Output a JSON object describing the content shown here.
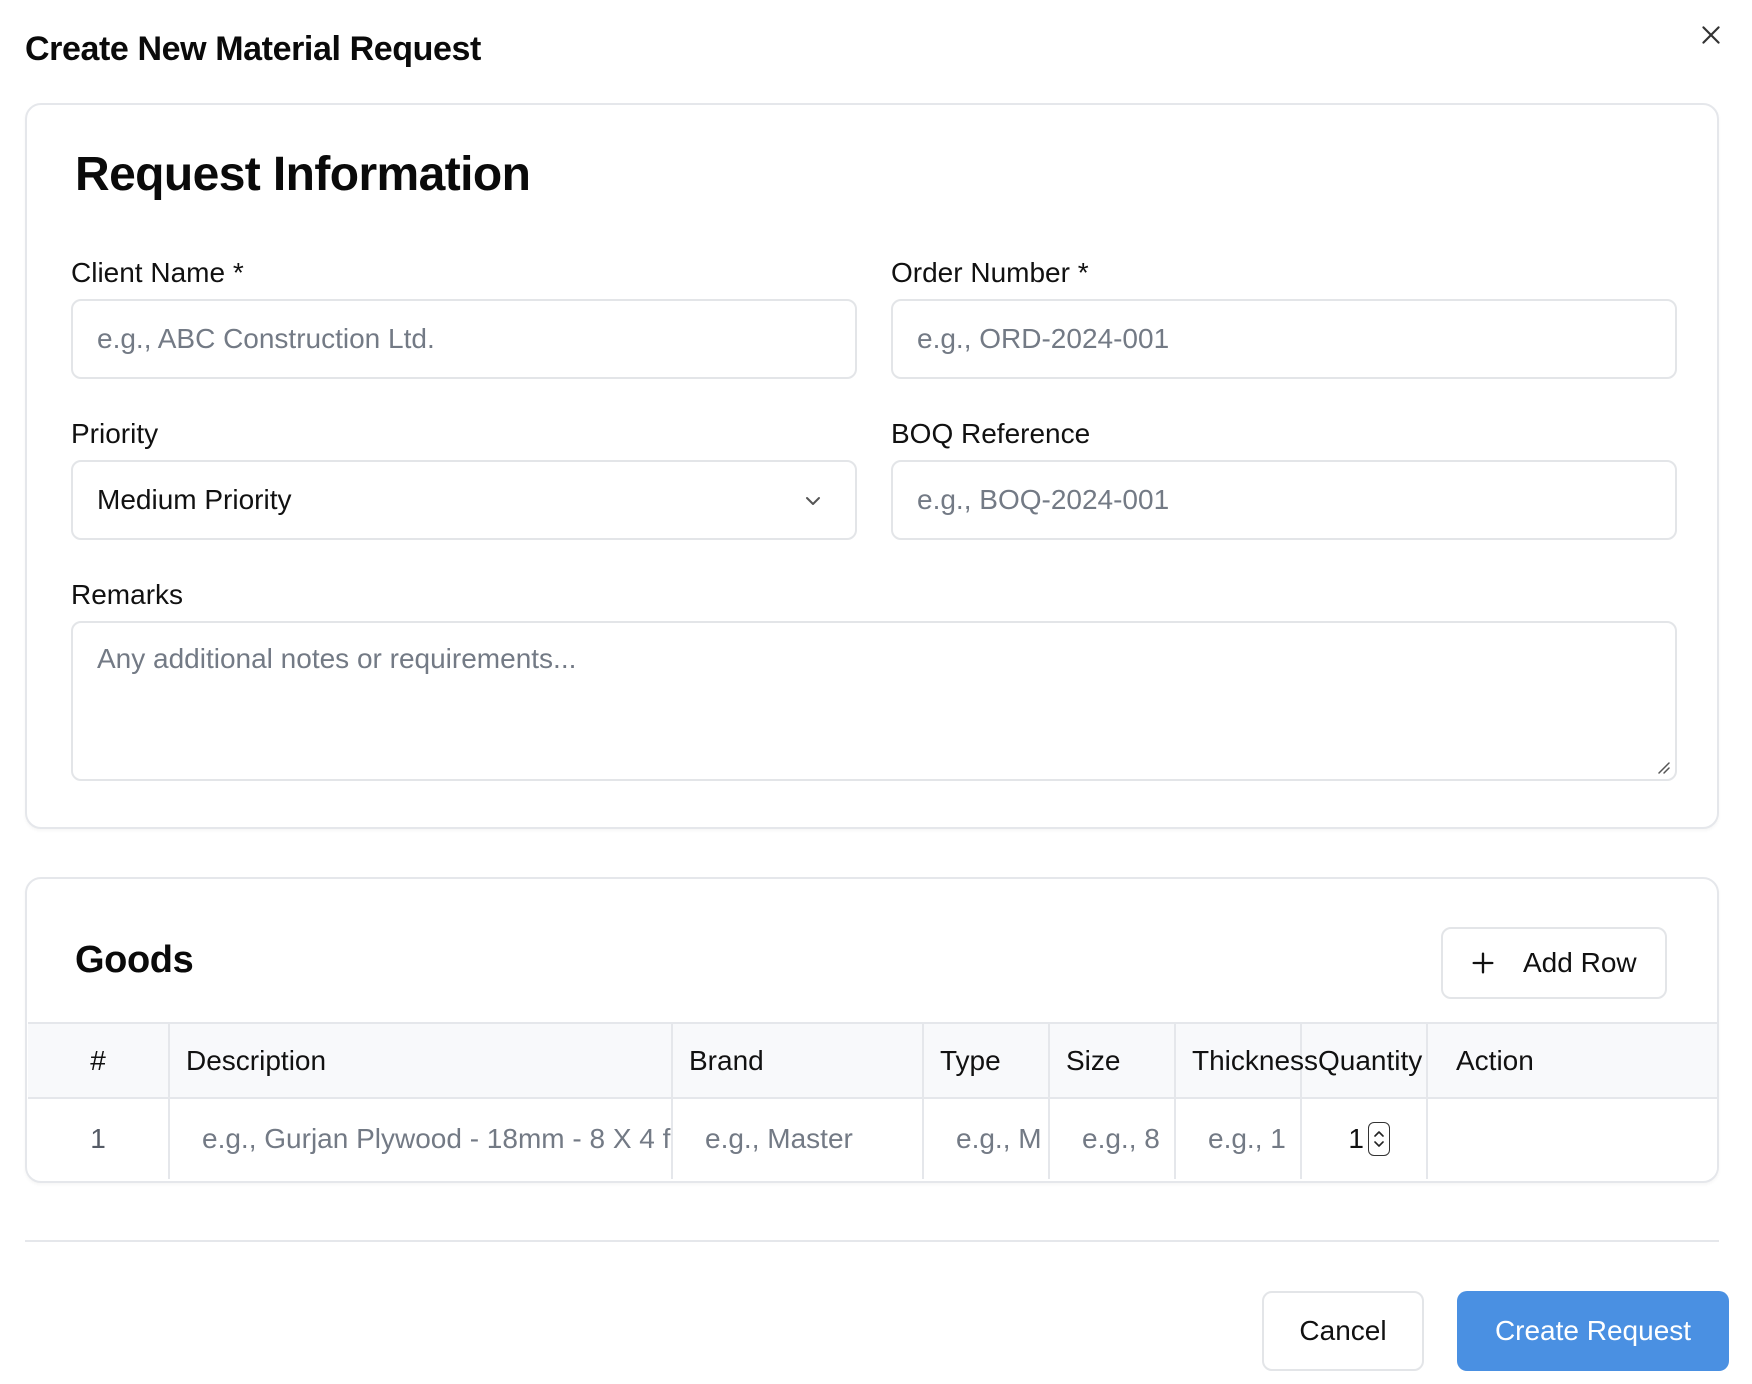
{
  "dialog": {
    "title": "Create New Material Request"
  },
  "request_info": {
    "title": "Request Information",
    "client_name": {
      "label": "Client Name *",
      "placeholder": "e.g., ABC Construction Ltd.",
      "value": ""
    },
    "order_number": {
      "label": "Order Number *",
      "placeholder": "e.g., ORD-2024-001",
      "value": ""
    },
    "priority": {
      "label": "Priority",
      "selected": "Medium Priority"
    },
    "boq_reference": {
      "label": "BOQ Reference",
      "placeholder": "e.g., BOQ-2024-001",
      "value": ""
    },
    "remarks": {
      "label": "Remarks",
      "placeholder": "Any additional notes or requirements...",
      "value": ""
    }
  },
  "goods": {
    "title": "Goods",
    "add_row_label": "Add Row",
    "columns": [
      "#",
      "Description",
      "Brand",
      "Type",
      "Size",
      "Thickness",
      "Quantity",
      "Action"
    ],
    "rows": [
      {
        "index": "1",
        "description_placeholder": "e.g., Gurjan Plywood - 18mm - 8 X 4 f",
        "brand_placeholder": "e.g., Master",
        "type_placeholder": "e.g., M",
        "size_placeholder": "e.g., 8",
        "thickness_placeholder": "e.g., 1",
        "quantity": "1"
      }
    ]
  },
  "footer": {
    "cancel_label": "Cancel",
    "submit_label": "Create Request"
  },
  "colors": {
    "primary": "#4a90e2",
    "border": "#e5e7eb",
    "placeholder": "#737a85"
  }
}
